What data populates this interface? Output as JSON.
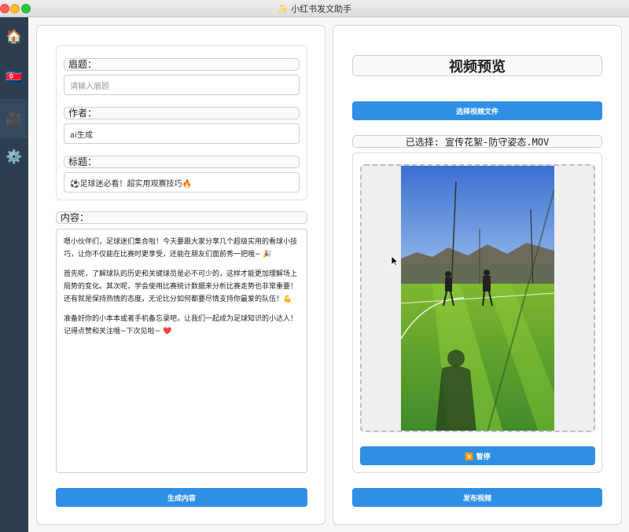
{
  "window": {
    "title": "✨ 小红书发文助手"
  },
  "sidebar": {
    "items": [
      {
        "icon": "🏠",
        "name": "home"
      },
      {
        "icon": "🇰🇵",
        "name": "flag"
      },
      {
        "icon": "🎥",
        "name": "video"
      },
      {
        "icon": "⚙️",
        "name": "settings"
      }
    ],
    "active_index": 2
  },
  "left": {
    "eyebrow_label": "眉题：",
    "eyebrow_placeholder": "请输入眉题",
    "author_label": "作者：",
    "author_value": "ai生成",
    "headline_label": "标题：",
    "headline_value": "⚽足球迷必看！超实用观赛技巧🔥",
    "content_label": "内容：",
    "content_paragraphs": [
      "嗯小伙伴们，足球迷们集合啦！今天要跟大家分享几个超级实用的看球小技巧，让你不仅能在比赛时更享受，还能在朋友们面前秀一把哦~ 🎉",
      "首先呢，了解球队的历史和关键球员是必不可少的，这样才能更加理解场上局势的变化。其次呢，学会使用比赛统计数据来分析比赛走势也非常重要！还有就是保持热情的态度，无论比分如何都要尽情支持你最爱的队伍！💪",
      "准备好你的小本本或者手机备忘录吧，让我们一起成为足球知识的小达人！记得点赞和关注哦~下次见啦~ ❤️"
    ],
    "generate_button": "生成内容"
  },
  "right": {
    "preview_title": "视频预览",
    "select_button": "选择视频文件",
    "selected_text": "已选择: 宣传花絮-防守姿态.MOV",
    "pause_button": "⏸️ 暂停",
    "publish_button": "发布视频"
  },
  "colors": {
    "accent": "#2f8fe6",
    "sidebar": "#2c3e50"
  }
}
